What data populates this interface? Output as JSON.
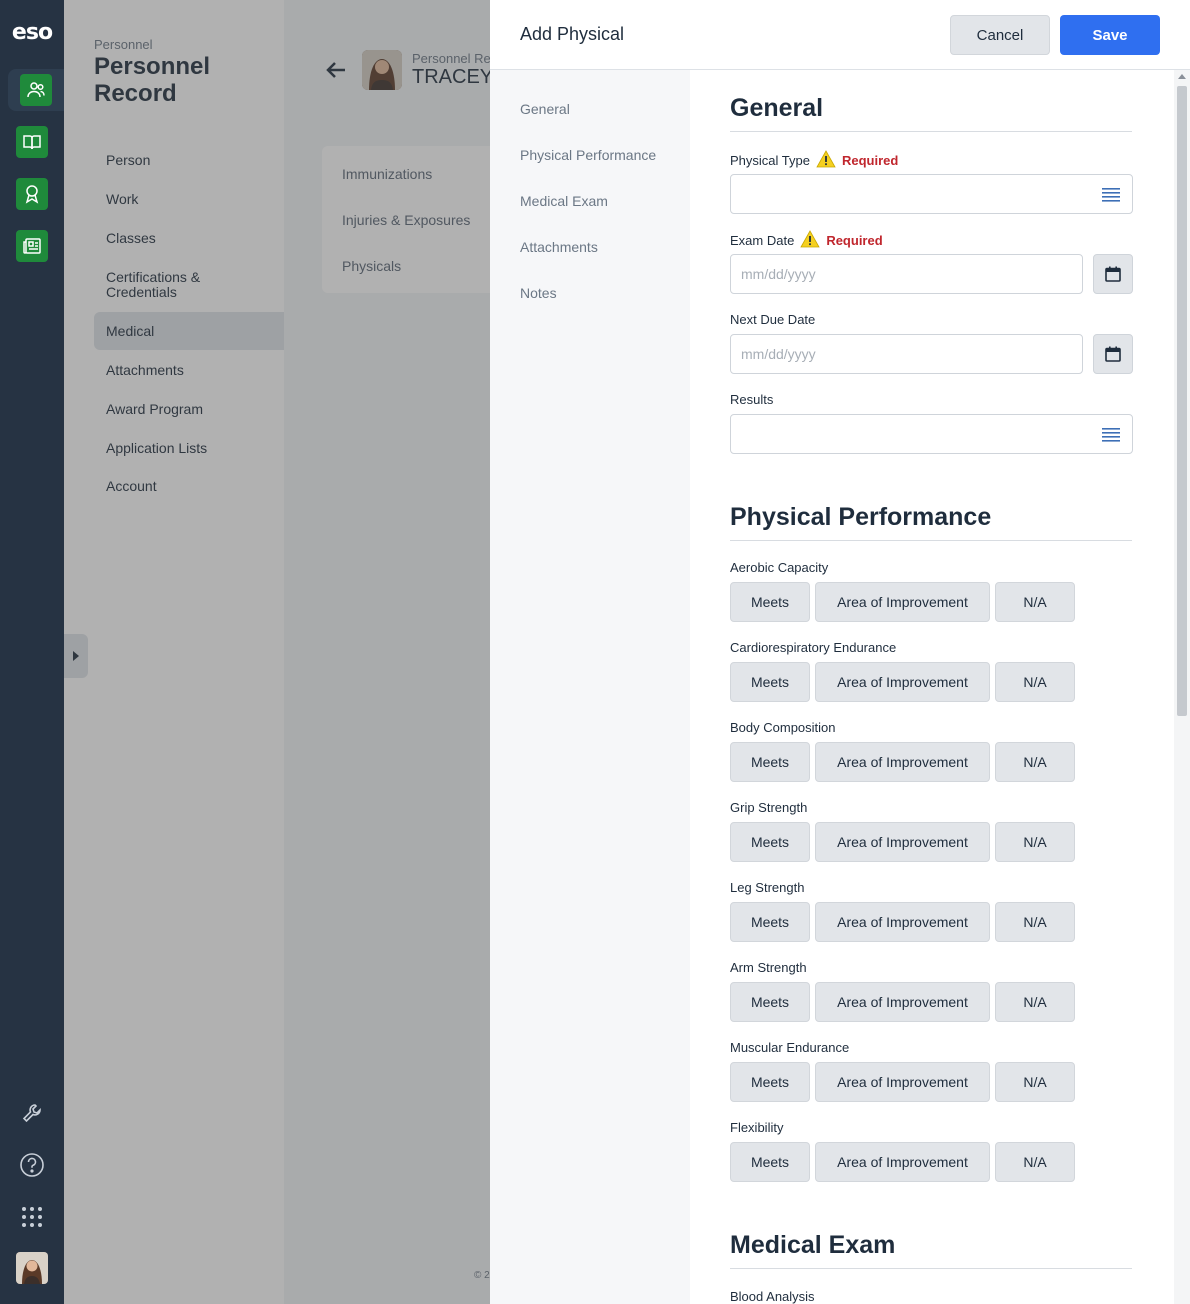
{
  "rail": {
    "logo": "eso",
    "apps": [
      "personnel-icon",
      "book-icon",
      "award-icon",
      "news-icon"
    ],
    "tools": [
      "wrench-icon",
      "help-icon",
      "apps-grid-icon"
    ],
    "accent": "#1f8a3b"
  },
  "personnel_nav": {
    "crumb": "Personnel",
    "title": "Personnel Record",
    "items": [
      {
        "label": "Person"
      },
      {
        "label": "Work"
      },
      {
        "label": "Classes"
      },
      {
        "label": "Certifications & Credentials"
      },
      {
        "label": "Medical"
      },
      {
        "label": "Attachments"
      },
      {
        "label": "Award Program"
      },
      {
        "label": "Application Lists"
      },
      {
        "label": "Account"
      }
    ],
    "active_item": "Medical"
  },
  "background": {
    "record_label": "Personnel Re",
    "person_name": "TRACEY",
    "medical_items": [
      "Immunizations",
      "Injuries & Exposures",
      "Physicals"
    ],
    "footer_text": "© 2"
  },
  "drawer": {
    "title": "Add Physical",
    "cancel_label": "Cancel",
    "save_label": "Save",
    "nav": [
      "General",
      "Physical Performance",
      "Medical Exam",
      "Attachments",
      "Notes"
    ],
    "general": {
      "title": "General",
      "physical_type_label": "Physical Type",
      "required_text": "Required",
      "exam_date_label": "Exam Date",
      "next_due_label": "Next Due Date",
      "date_placeholder": "mm/dd/yyyy",
      "results_label": "Results"
    },
    "performance": {
      "title": "Physical Performance",
      "options": {
        "meets": "Meets",
        "improve": "Area of Improvement",
        "na": "N/A"
      },
      "metrics": [
        {
          "label": "Aerobic Capacity"
        },
        {
          "label": "Cardiorespiratory Endurance"
        },
        {
          "label": "Body Composition"
        },
        {
          "label": "Grip Strength"
        },
        {
          "label": "Leg Strength"
        },
        {
          "label": "Arm Strength"
        },
        {
          "label": "Muscular Endurance"
        },
        {
          "label": "Flexibility"
        }
      ]
    },
    "medical_exam": {
      "title": "Medical Exam",
      "first_field_label": "Blood Analysis"
    }
  }
}
